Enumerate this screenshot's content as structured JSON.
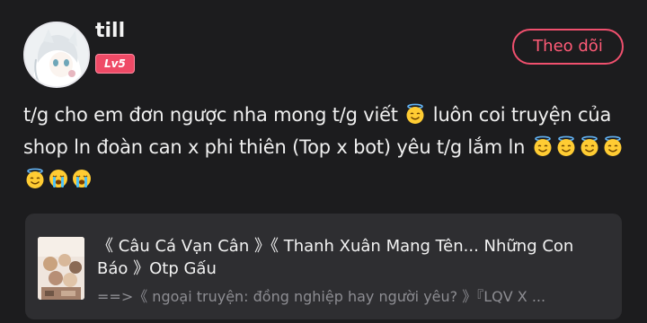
{
  "user": {
    "name": "till",
    "level": "Lv5",
    "avatar_icon": "anime-avatar-icon"
  },
  "follow_button": {
    "label": "Theo dõi"
  },
  "comment": {
    "segments": [
      {
        "type": "text",
        "value": "t/g cho em đơn ngược nha mong t/g viết "
      },
      {
        "type": "emoji",
        "icon": "smiling-face-with-halo"
      },
      {
        "type": "text",
        "value": " luôn coi truyện của shop ln đoàn can x phi thiên (Top x bot) yêu t/g lắm ln "
      },
      {
        "type": "emoji",
        "icon": "smiling-face-with-halo"
      },
      {
        "type": "emoji",
        "icon": "smiling-face-with-halo"
      },
      {
        "type": "emoji",
        "icon": "smiling-face-with-halo"
      },
      {
        "type": "emoji",
        "icon": "smiling-face-with-halo"
      },
      {
        "type": "emoji",
        "icon": "smiling-face-with-halo"
      },
      {
        "type": "emoji",
        "icon": "loudly-crying-face"
      },
      {
        "type": "emoji",
        "icon": "loudly-crying-face"
      }
    ]
  },
  "book": {
    "title": "《 Câu Cá Vạn Cân 》《 Thanh Xuân Mang Tên... Những Con Báo 》Otp Gấu",
    "subtitle": "==>《 ngoại truyện: đồng nghiệp hay người yêu? 》『LQV X ...",
    "cover_icon": "book-cover-image"
  },
  "colors": {
    "background": "#1c1c1e",
    "accent": "#f0506e",
    "card": "#2e2e31",
    "muted_text": "#8d8d92"
  }
}
